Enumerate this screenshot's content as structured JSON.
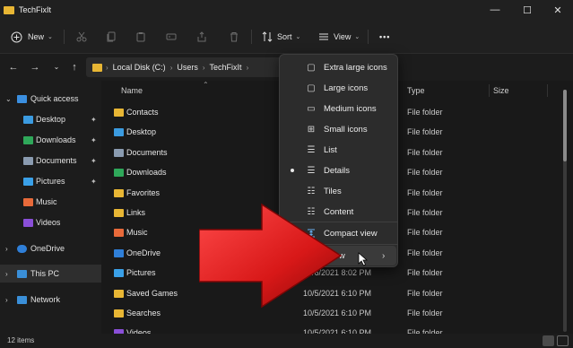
{
  "window": {
    "title": "TechFixIt",
    "minimize": "—",
    "maximize": "☐",
    "close": "✕"
  },
  "toolbar": {
    "new_label": "New",
    "sort_label": "Sort",
    "view_label": "View",
    "more_label": "•••"
  },
  "address": {
    "crumbs": [
      "Local Disk (C:)",
      "Users",
      "TechFixIt"
    ],
    "separator": "›"
  },
  "nav": {
    "quick_access": "Quick access",
    "items": [
      {
        "label": "Desktop",
        "icon": "desktop-icon",
        "pinned": true
      },
      {
        "label": "Downloads",
        "icon": "downloads-icon",
        "pinned": true
      },
      {
        "label": "Documents",
        "icon": "documents-icon",
        "pinned": true
      },
      {
        "label": "Pictures",
        "icon": "pictures-icon",
        "pinned": true
      },
      {
        "label": "Music",
        "icon": "music-icon",
        "pinned": false
      },
      {
        "label": "Videos",
        "icon": "videos-icon",
        "pinned": false
      }
    ],
    "onedrive": "OneDrive",
    "this_pc": "This PC",
    "network": "Network",
    "pin_glyph": "📌"
  },
  "columns": {
    "name": "Name",
    "type": "Type",
    "size": "Size"
  },
  "files": [
    {
      "name": "Contacts",
      "date": "",
      "type": "File folder",
      "color": "#e8b634"
    },
    {
      "name": "Desktop",
      "date": "",
      "type": "File folder",
      "color": "#3b9be0"
    },
    {
      "name": "Documents",
      "date": "",
      "type": "File folder",
      "color": "#8a9bb0"
    },
    {
      "name": "Downloads",
      "date": "",
      "type": "File folder",
      "color": "#2fa85a"
    },
    {
      "name": "Favorites",
      "date": "",
      "type": "File folder",
      "color": "#e8b634"
    },
    {
      "name": "Links",
      "date": "",
      "type": "File folder",
      "color": "#e8b634"
    },
    {
      "name": "Music",
      "date": "",
      "type": "File folder",
      "color": "#e86a3a"
    },
    {
      "name": "OneDrive",
      "date": "",
      "type": "File folder",
      "color": "#2f7fd8"
    },
    {
      "name": "Pictures",
      "date": "10/6/2021 8:02 PM",
      "type": "File folder",
      "color": "#3aa0e8"
    },
    {
      "name": "Saved Games",
      "date": "10/5/2021 6:10 PM",
      "type": "File folder",
      "color": "#e8b634"
    },
    {
      "name": "Searches",
      "date": "10/5/2021 6:10 PM",
      "type": "File folder",
      "color": "#e8b634"
    },
    {
      "name": "Videos",
      "date": "10/5/2021 6:10 PM",
      "type": "File folder",
      "color": "#8a4fd8"
    }
  ],
  "status": {
    "count": "12 items"
  },
  "view_menu": {
    "items": [
      {
        "label": "Extra large icons",
        "icon": "extra-large-icons-icon",
        "glyph": "▢",
        "selected": false
      },
      {
        "label": "Large icons",
        "icon": "large-icons-icon",
        "glyph": "▢",
        "selected": false
      },
      {
        "label": "Medium icons",
        "icon": "medium-icons-icon",
        "glyph": "▭",
        "selected": false
      },
      {
        "label": "Small icons",
        "icon": "small-icons-icon",
        "glyph": "⊞",
        "selected": false
      },
      {
        "label": "List",
        "icon": "list-icon",
        "glyph": "☰",
        "selected": false
      },
      {
        "label": "Details",
        "icon": "details-icon",
        "glyph": "☰",
        "selected": true
      },
      {
        "label": "Tiles",
        "icon": "tiles-icon",
        "glyph": "☷",
        "selected": false
      },
      {
        "label": "Content",
        "icon": "content-icon",
        "glyph": "☷",
        "selected": false
      }
    ],
    "compact_label": "Compact view",
    "show_label": "Show",
    "submenu_glyph": "›"
  },
  "colors": {
    "accent_red": "#e02020",
    "folder_yellow": "#e8b634",
    "background": "#191919"
  }
}
